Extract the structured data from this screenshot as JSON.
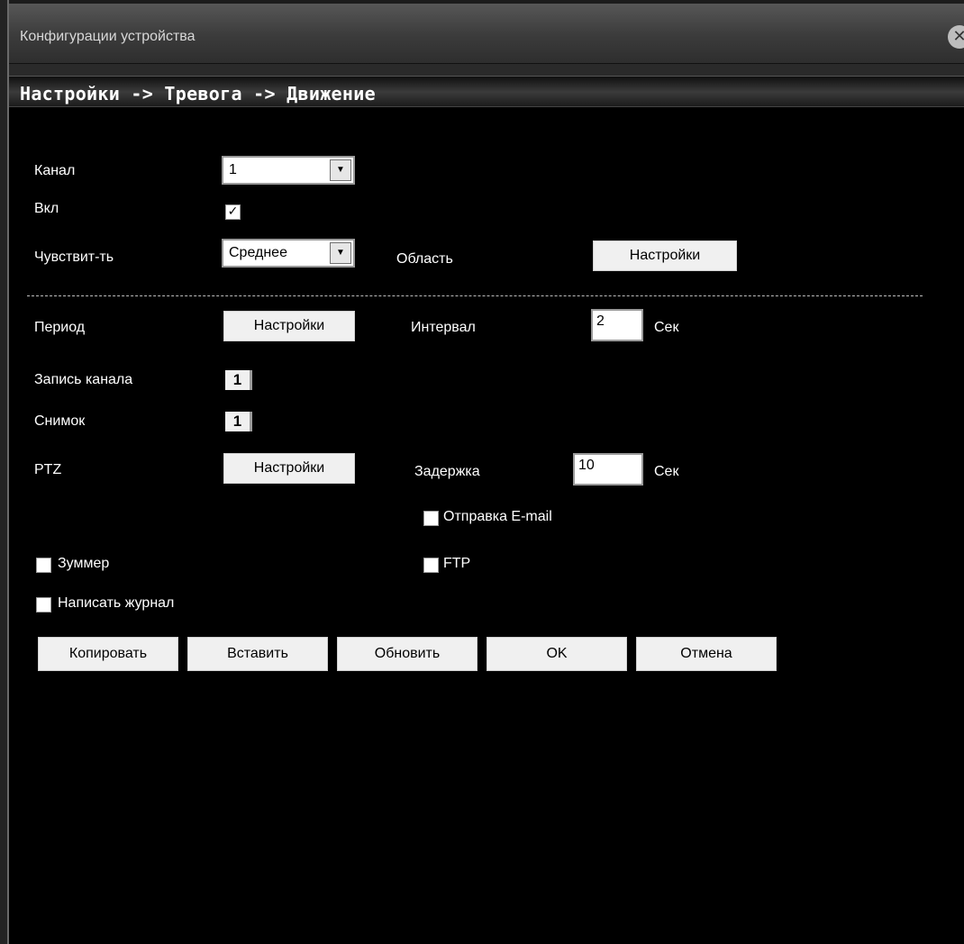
{
  "window": {
    "title": "Конфигурации устройства",
    "close_glyph": "✕"
  },
  "header": {
    "path": "Настройки -> Тревога -> Движение"
  },
  "form": {
    "channel": {
      "label": "Канал",
      "value": "1"
    },
    "enable": {
      "label": "Вкл",
      "checked": true
    },
    "sensitivity": {
      "label": "Чувствит-ть",
      "value": "Среднее"
    },
    "area": {
      "label": "Область",
      "button": "Настройки"
    },
    "period": {
      "label": "Период",
      "button": "Настройки"
    },
    "interval": {
      "label": "Интервал",
      "value": "2",
      "unit": "Сек"
    },
    "record_channel": {
      "label": "Запись канала",
      "value": "1"
    },
    "snapshot": {
      "label": "Снимок",
      "value": "1"
    },
    "ptz": {
      "label": "PTZ",
      "button": "Настройки"
    },
    "delay": {
      "label": "Задержка",
      "value": "10",
      "unit": "Сек"
    },
    "send_email": {
      "label": "Отправка E-mail",
      "checked": false
    },
    "buzzer": {
      "label": "Зуммер",
      "checked": false
    },
    "ftp": {
      "label": "FTP",
      "checked": false
    },
    "write_log": {
      "label": "Написать журнал",
      "checked": false
    }
  },
  "actions": {
    "copy": "Копировать",
    "paste": "Вставить",
    "refresh": "Обновить",
    "ok": "OK",
    "cancel": "Отмена"
  },
  "colors": {
    "background": "#000000",
    "button": "#f0f0f0",
    "text": "#ffffff"
  }
}
